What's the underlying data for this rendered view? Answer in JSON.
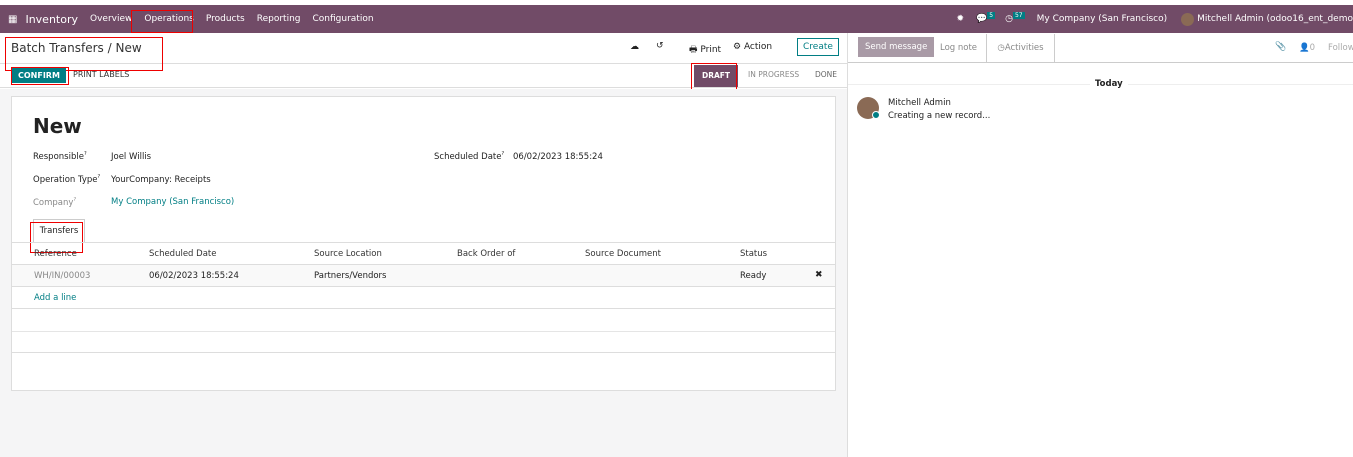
{
  "navbar": {
    "app": "Inventory",
    "menu": [
      "Overview",
      "Operations",
      "Products",
      "Reporting",
      "Configuration"
    ],
    "messages_count": "5",
    "activities_count": "57",
    "company": "My Company (San Francisco)",
    "user": "Mitchell Admin (odoo16_ent_demo"
  },
  "breadcrumb": {
    "parent": "Batch Transfers",
    "sep": "/",
    "current": "New"
  },
  "control": {
    "print": "Print",
    "action": "Action",
    "create": "Create"
  },
  "statusbar": {
    "buttons": {
      "confirm": "CONFIRM",
      "print_labels": "PRINT LABELS"
    },
    "stages": [
      "DRAFT",
      "IN PROGRESS",
      "DONE"
    ],
    "active": "DRAFT"
  },
  "form": {
    "title": "New",
    "fields": {
      "responsible_label": "Responsible",
      "responsible": "Joel Willis",
      "operation_type_label": "Operation Type",
      "operation_type": "YourCompany: Receipts",
      "company_label": "Company",
      "company": "My Company (San Francisco)",
      "scheduled_label": "Scheduled Date",
      "scheduled": "06/02/2023 18:55:24",
      "help": "?"
    },
    "tab": "Transfers",
    "table": {
      "columns": [
        "Reference",
        "Scheduled Date",
        "Source Location",
        "Back Order of",
        "Source Document",
        "Status"
      ],
      "rows": [
        [
          "WH/IN/00003",
          "06/02/2023 18:55:24",
          "Partners/Vendors",
          "",
          "",
          "Ready"
        ]
      ],
      "add_line": "Add a line"
    }
  },
  "chatter": {
    "send_message": "Send message",
    "log_note": "Log note",
    "activities": "Activities",
    "followers_count": "0",
    "follow": "Follow",
    "date_separator": "Today",
    "messages": [
      {
        "author": "Mitchell Admin",
        "body": "Creating a new record..."
      }
    ]
  }
}
